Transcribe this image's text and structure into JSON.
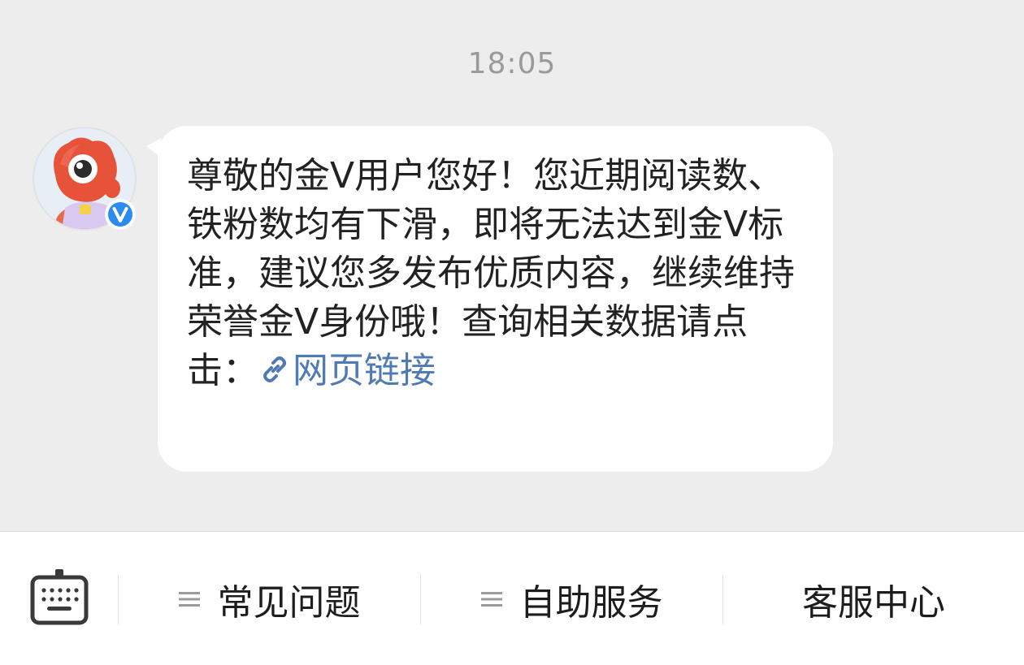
{
  "chat": {
    "timestamp": "18:05",
    "message": {
      "text": "尊敬的金V用户您好！您近期阅读数、铁粉数均有下滑，即将无法达到金V标准，建议您多发布优质内容，继续维持荣誉金V身份哦！查询相关数据请点击：",
      "link_label": "网页链接",
      "link_icon": "link-icon",
      "link_color": "#4f7ab2"
    },
    "avatar": {
      "icon": "weibo-mascot-avatar",
      "badge_icon": "verified-v-badge-icon",
      "badge_color": "#2a8bf0"
    }
  },
  "bottom_menu": {
    "keyboard_icon": "keyboard-icon",
    "items": [
      {
        "label": "常见问题",
        "icon": "menu-lines-icon"
      },
      {
        "label": "自助服务",
        "icon": "menu-lines-icon"
      },
      {
        "label": "客服中心"
      }
    ]
  },
  "colors": {
    "chat_background": "#ededed",
    "bubble": "#ffffff",
    "text": "#222222",
    "timestamp": "#9a9a9a"
  }
}
